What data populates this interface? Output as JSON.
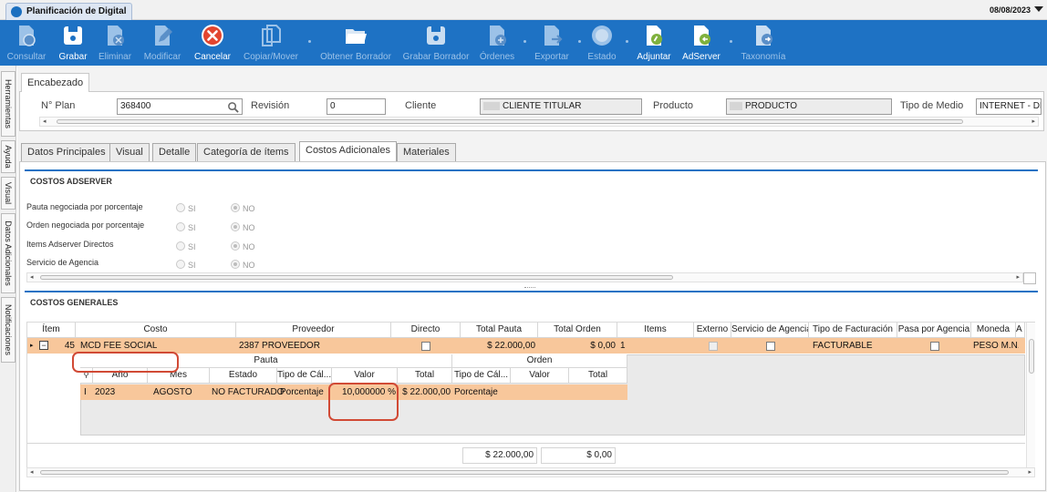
{
  "window": {
    "tab_title": "Planificación de Digital",
    "date": "08/08/2023"
  },
  "toolbar": {
    "items": [
      {
        "label": "Consultar",
        "icon": "search-doc-icon"
      },
      {
        "label": "Grabar",
        "icon": "save-icon"
      },
      {
        "label": "Eliminar",
        "icon": "delete-doc-icon"
      },
      {
        "label": "Modificar",
        "icon": "edit-icon"
      },
      {
        "label": "Cancelar",
        "icon": "cancel-icon"
      },
      {
        "label": "Copiar/Mover",
        "icon": "copy-icon"
      },
      {
        "label": "Obtener Borrador",
        "icon": "folder-open-icon"
      },
      {
        "label": "Grabar Borrador",
        "icon": "save-draft-icon"
      },
      {
        "label": "Órdenes",
        "icon": "orders-icon"
      },
      {
        "label": "Exportar",
        "icon": "export-icon"
      },
      {
        "label": "Estado",
        "icon": "status-icon"
      },
      {
        "label": "Adjuntar",
        "icon": "attach-icon"
      },
      {
        "label": "AdServer",
        "icon": "adserver-icon"
      },
      {
        "label": "Taxonomía",
        "icon": "taxonomy-icon"
      }
    ]
  },
  "sidebar": {
    "tabs": [
      "Herramientas",
      "Ayuda",
      "Visual",
      "Datos Adicionales",
      "Notificaciones"
    ]
  },
  "header": {
    "group_label": "Encabezado",
    "plan_label": "N° Plan",
    "plan_value": "368400",
    "revision_label": "Revisión",
    "revision_value": "0",
    "cliente_label": "Cliente",
    "cliente_value": "CLIENTE TITULAR",
    "producto_label": "Producto",
    "producto_value": "PRODUCTO",
    "tipo_medio_label": "Tipo de Medio",
    "tipo_medio_value": "INTERNET - DIGI"
  },
  "tabs": [
    "Datos Principales",
    "Visual",
    "Detalle",
    "Categoría de ítems",
    "Costos Adicionales",
    "Materiales"
  ],
  "adserver": {
    "title": "COSTOS ADSERVER",
    "si": "SI",
    "no": "NO",
    "rows": [
      "Pauta negociada por porcentaje",
      "Orden negociada por porcentaje",
      "Items Adserver Directos",
      "Servicio de Agencia"
    ]
  },
  "generales": {
    "title": "COSTOS GENERALES",
    "columns": [
      "Ítem",
      "Costo",
      "Proveedor",
      "Directo",
      "Total Pauta",
      "Total Orden",
      "Items",
      "Externo",
      "Servicio de Agencia",
      "Tipo de Facturación",
      "Pasa por Agencia",
      "Moneda",
      "A"
    ],
    "row": {
      "item": "45",
      "costo": "MCD FEE SOCIAL",
      "proveedor": "2387 PROVEEDOR",
      "total_pauta": "$ 22.000,00",
      "total_orden": "$ 0,00",
      "items": "1",
      "tipo_facturacion": "FACTURABLE",
      "moneda": "PESO M.N."
    },
    "detail": {
      "group_pauta": "Pauta",
      "group_orden": "Orden",
      "columns": [
        "Año",
        "Mes",
        "Estado",
        "Tipo de Cál...",
        "Valor",
        "Total",
        "Tipo de Cál...",
        "Valor",
        "Total"
      ],
      "row": {
        "anio": "2023",
        "mes": "AGOSTO",
        "estado": "NO FACTURADO",
        "tipo_calc": "Porcentaje",
        "valor": "10,000000 %",
        "total": "$ 22.000,00",
        "tipo_calc_orden": "Porcentaje"
      }
    },
    "footer": {
      "total_pauta": "$ 22.000,00",
      "total_orden": "$ 0,00"
    }
  },
  "colors": {
    "toolbar": "#1e72c4",
    "row_selected": "#f8c79b",
    "highlight": "#d14a35"
  }
}
